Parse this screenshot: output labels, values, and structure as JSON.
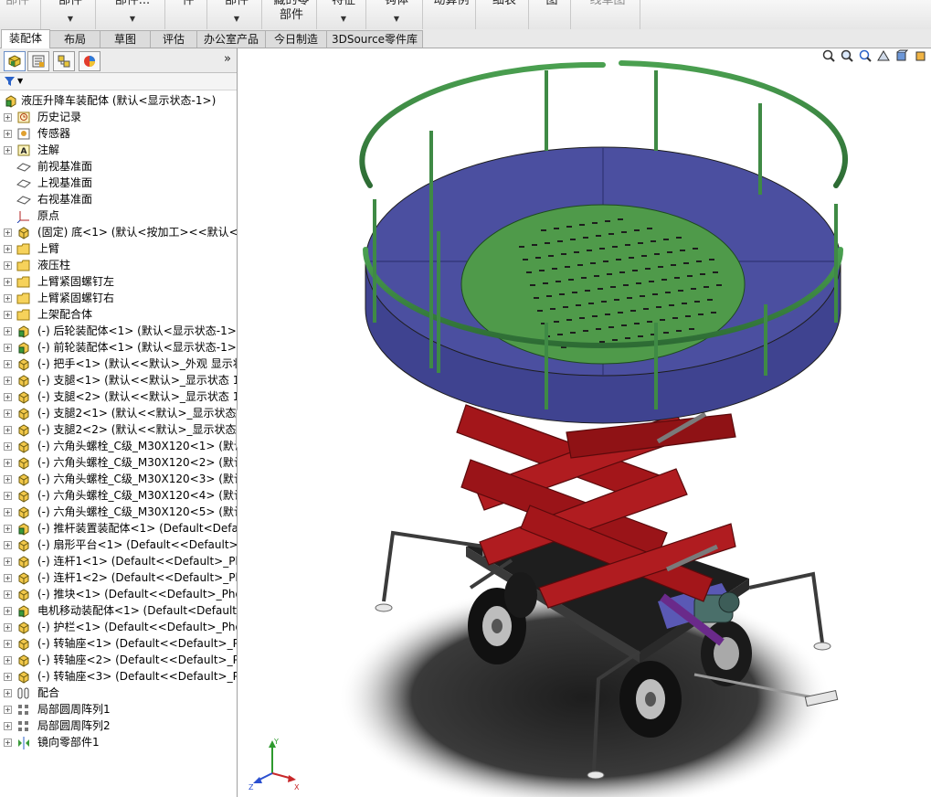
{
  "ribbon": {
    "groups": [
      {
        "top": "部件",
        "bottom": "",
        "dim": true
      },
      {
        "top": "部件",
        "bottom": "",
        "arrow": true
      },
      {
        "top": "部件...",
        "bottom": "",
        "arrow": true
      },
      {
        "top": "件",
        "bottom": ""
      },
      {
        "top": "部件",
        "bottom": "",
        "arrow": true
      },
      {
        "top": "藏的零",
        "bottom": "部件"
      },
      {
        "top": "特征",
        "bottom": "",
        "arrow": true
      },
      {
        "top": "钩体",
        "bottom": "",
        "arrow": true
      },
      {
        "top": "动算例",
        "bottom": ""
      },
      {
        "top": "细表",
        "bottom": ""
      },
      {
        "top": "图",
        "bottom": ""
      },
      {
        "top": "线草图",
        "bottom": "",
        "dim": true
      }
    ]
  },
  "command_tabs": [
    "装配体",
    "布局",
    "草图",
    "评估",
    "办公室产品",
    "今日制造",
    "3DSource零件库"
  ],
  "feature_manager": {
    "expand_glyph": "»",
    "root": "液压升降车装配体  (默认<显示状态-1>)",
    "items": [
      {
        "label": "历史记录",
        "icon": "history-icon"
      },
      {
        "label": "传感器",
        "icon": "sensor-icon"
      },
      {
        "label": "注解",
        "icon": "annotation-icon"
      },
      {
        "label": "前视基准面",
        "icon": "plane-icon"
      },
      {
        "label": "上视基准面",
        "icon": "plane-icon"
      },
      {
        "label": "右视基准面",
        "icon": "plane-icon"
      },
      {
        "label": "原点",
        "icon": "origin-icon"
      },
      {
        "label": "(固定) 底<1> (默认<按加工><<默认<按",
        "icon": "part-icon"
      },
      {
        "label": "上臂",
        "icon": "folder-icon"
      },
      {
        "label": "液压柱",
        "icon": "folder-icon"
      },
      {
        "label": "上臂紧固螺钉左",
        "icon": "folder-icon"
      },
      {
        "label": "上臂紧固螺钉右",
        "icon": "folder-icon"
      },
      {
        "label": "上架配合体",
        "icon": "folder-icon"
      },
      {
        "label": "(-) 后轮装配体<1> (默认<显示状态-1>)",
        "icon": "assembly-icon"
      },
      {
        "label": "(-) 前轮装配体<1> (默认<显示状态-1>)",
        "icon": "assembly-icon"
      },
      {
        "label": "(-) 把手<1> (默认<<默认>_外观 显示状",
        "icon": "part-icon"
      },
      {
        "label": "(-) 支腿<1> (默认<<默认>_显示状态 1>",
        "icon": "part-icon"
      },
      {
        "label": "(-) 支腿<2> (默认<<默认>_显示状态 1>",
        "icon": "part-icon"
      },
      {
        "label": "(-) 支腿2<1> (默认<<默认>_显示状态",
        "icon": "part-icon"
      },
      {
        "label": "(-) 支腿2<2> (默认<<默认>_显示状态",
        "icon": "part-icon"
      },
      {
        "label": "(-) 六角头螺栓_C级_M30X120<1> (默认",
        "icon": "part-icon"
      },
      {
        "label": "(-) 六角头螺栓_C级_M30X120<2> (默认",
        "icon": "part-icon"
      },
      {
        "label": "(-) 六角头螺栓_C级_M30X120<3> (默认",
        "icon": "part-icon"
      },
      {
        "label": "(-) 六角头螺栓_C级_M30X120<4> (默认",
        "icon": "part-icon"
      },
      {
        "label": "(-) 六角头螺栓_C级_M30X120<5> (默认",
        "icon": "part-icon"
      },
      {
        "label": "(-) 推杆装置装配体<1> (Default<Defau",
        "icon": "assembly-icon"
      },
      {
        "label": "(-) 扇形平台<1> (Default<<Default>_P",
        "icon": "part-icon"
      },
      {
        "label": "(-) 连杆1<1> (Default<<Default>_Phot",
        "icon": "part-icon"
      },
      {
        "label": "(-) 连杆1<2> (Default<<Default>_Phot",
        "icon": "part-icon"
      },
      {
        "label": "(-) 推块<1> (Default<<Default>_Photo",
        "icon": "part-icon"
      },
      {
        "label": "电机移动装配体<1> (Default<Default_D",
        "icon": "assembly-icon"
      },
      {
        "label": "(-) 护栏<1> (Default<<Default>_Photo",
        "icon": "part-icon"
      },
      {
        "label": "(-) 转轴座<1> (Default<<Default>_Pho",
        "icon": "part-icon"
      },
      {
        "label": "(-) 转轴座<2> (Default<<Default>_Pho",
        "icon": "part-icon"
      },
      {
        "label": "(-) 转轴座<3> (Default<<Default>_Pho",
        "icon": "part-icon"
      },
      {
        "label": "配合",
        "icon": "mates-icon"
      },
      {
        "label": "局部圆周阵列1",
        "icon": "pattern-icon"
      },
      {
        "label": "局部圆周阵列2",
        "icon": "pattern-icon"
      },
      {
        "label": "镜向零部件1",
        "icon": "mirror-icon"
      }
    ]
  },
  "graphics": {
    "triad": {
      "x": "X",
      "y": "Y",
      "z": "Z"
    },
    "colors": {
      "platform": "#4b4fa0",
      "deck": "#4f9a4a",
      "guardrail": "#3f8a45",
      "scissor": "#a3161a",
      "frame": "#2b2b2b",
      "shadow": "#2a2a2a"
    }
  }
}
